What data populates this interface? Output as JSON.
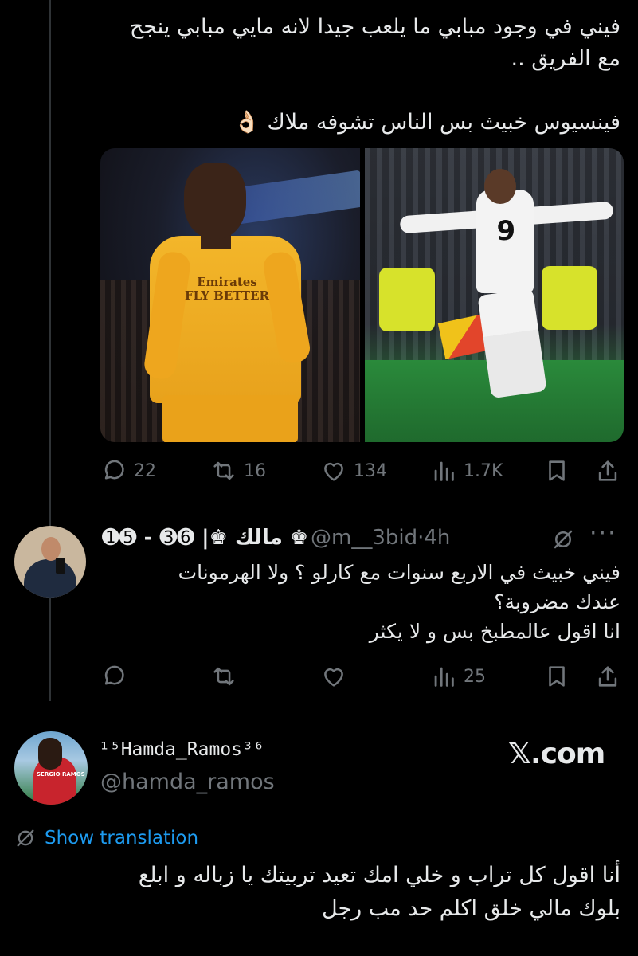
{
  "tweet1": {
    "lines": [
      "فيني في وجود مبابي ما يلعب جيدا لانه مايي مبابي ينجح",
      "مع الفريق ..",
      "فينسيوس خبيث بس الناس تشوفه ملاك 👌🏻"
    ],
    "photo_left_sponsor": "Emirates FLY BETTER",
    "photo_right_number": "9",
    "actions": {
      "replies": "22",
      "reposts": "16",
      "likes": "134",
      "views": "1.7K"
    }
  },
  "tweet2": {
    "name": "➊➎ - ➌➏ |♚ مالك ♚",
    "handle": "@m__3bid",
    "separator": "·",
    "time": "4h",
    "more": "···",
    "lines": [
      "فيني خبيث في الاربع سنوات مع كارلو ؟ ولا الهرمونات",
      "عندك مضروبة؟",
      "انا اقول عالمطبخ بس و لا يكثر"
    ],
    "actions": {
      "views": "25"
    }
  },
  "tweet3": {
    "name": "¹⁵Hamda_Ramos³⁶",
    "handle": "@hamda_ramos",
    "brand": "𝕏.com",
    "avatar_text": "SERGIO RAMOS",
    "show_translation": "Show translation",
    "lines": [
      "أنا اقول كل تراب و خلي امك تعيد تربيتك يا زباله و ابلع",
      "بلوك مالي خلق اكلم حد مب رجل"
    ]
  },
  "colors": {
    "background": "#000000",
    "text": "#e7e9ea",
    "muted": "#71767b",
    "link": "#1d9bf0"
  },
  "icons": [
    "reply-icon",
    "repost-icon",
    "like-icon",
    "views-icon",
    "bookmark-icon",
    "share-icon",
    "grok-icon",
    "more-icon",
    "translate-icon"
  ]
}
